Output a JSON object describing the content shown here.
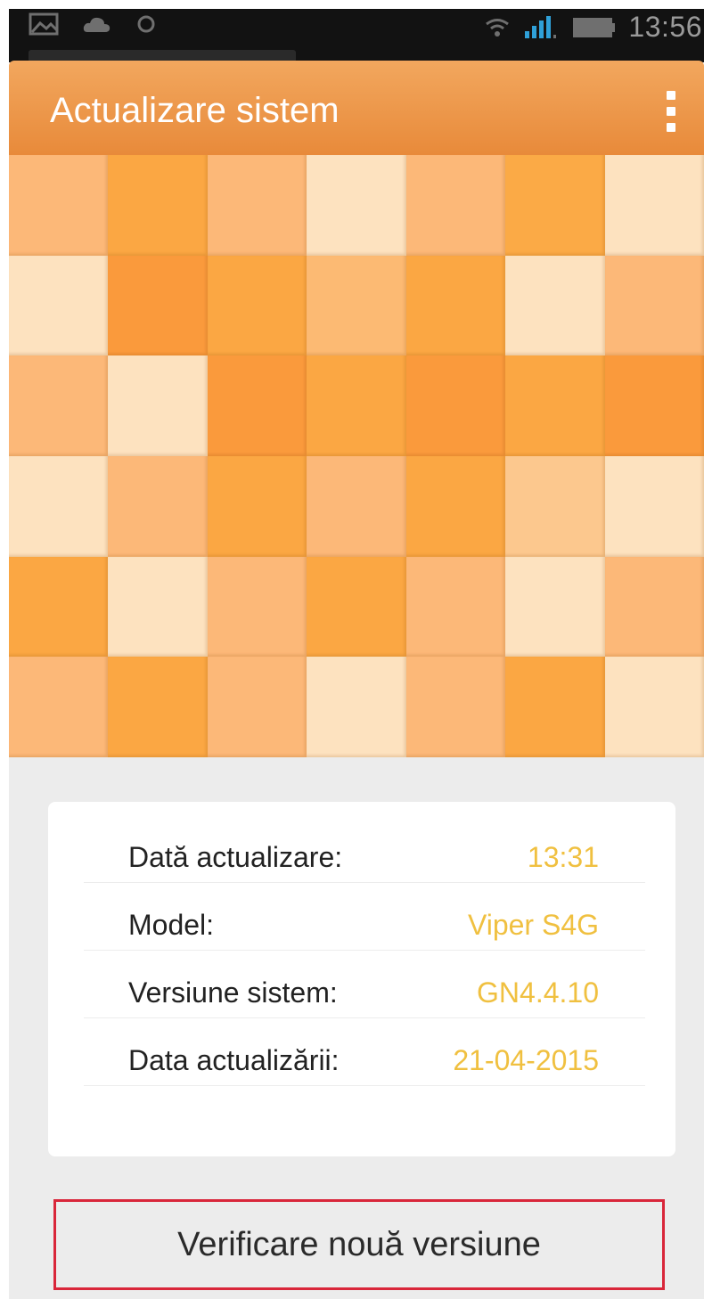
{
  "status_bar": {
    "time": "13:56",
    "icons": [
      "image-icon",
      "cloud-icon",
      "sync-icon",
      "wifi-icon",
      "signal-icon",
      "battery-icon"
    ]
  },
  "app_bar": {
    "title": "Actualizare sistem",
    "menu_icon": "overflow-menu-icon"
  },
  "banner": {
    "tiles": [
      "#fcb878",
      "#fba743",
      "#fcb878",
      "#fde2bf",
      "#fcb878",
      "#fbaa46",
      "#fde2bf",
      "#fde2bf",
      "#fa9a3c",
      "#fba743",
      "#fcba73",
      "#fba743",
      "#fde2bf",
      "#fcb878",
      "#fcb878",
      "#fde2bf",
      "#fa9a3c",
      "#fba743",
      "#fa9a3c",
      "#fba743",
      "#fa9a3c",
      "#fde2bf",
      "#fcb878",
      "#fba743",
      "#fcb878",
      "#fba743",
      "#fcc88e",
      "#fde2bf",
      "#fba743",
      "#fde2bf",
      "#fcb878",
      "#fba743",
      "#fcb878",
      "#fde2bf",
      "#fcb878",
      "#fcb878",
      "#fba743",
      "#fcb878",
      "#fde2bf",
      "#fcb878",
      "#fba743",
      "#fde2bf"
    ]
  },
  "info": {
    "rows": [
      {
        "label": "Dată actualizare:",
        "value": "13:31"
      },
      {
        "label": "Model:",
        "value": "Viper S4G"
      },
      {
        "label": "Versiune sistem:",
        "value": "GN4.4.10"
      },
      {
        "label": "Data actualizării:",
        "value": "21-04-2015"
      }
    ]
  },
  "actions": {
    "check_button": "Verificare nouă versiune"
  },
  "colors": {
    "app_bar": "#ec9447",
    "value_text": "#f0c040",
    "highlight_border": "#d9263a",
    "background": "#ececec"
  }
}
